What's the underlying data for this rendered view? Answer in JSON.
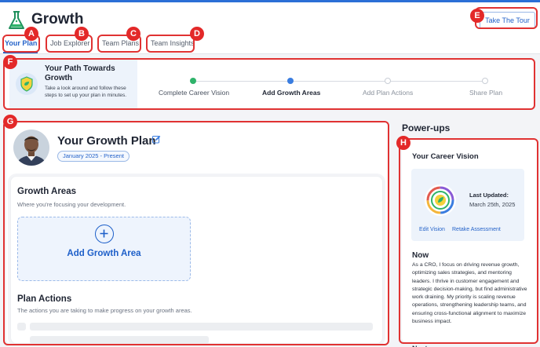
{
  "app": {
    "title": "Growth",
    "tour_button": "Take The Tour"
  },
  "tabs": [
    {
      "label": "Your Plan",
      "active": true
    },
    {
      "label": "Job Explorer",
      "active": false
    },
    {
      "label": "Team Plans",
      "active": false
    },
    {
      "label": "Team Insights",
      "active": false
    }
  ],
  "annotations": [
    "A",
    "B",
    "C",
    "D",
    "E",
    "F",
    "G",
    "H"
  ],
  "path": {
    "title": "Your Path Towards Growth",
    "description": "Take a look around and follow these steps to set up your plan in minutes.",
    "steps": [
      {
        "label": "Complete Career Vision",
        "status": "complete"
      },
      {
        "label": "Add Growth Areas",
        "status": "current"
      },
      {
        "label": "Add Plan Actions",
        "status": "pending"
      },
      {
        "label": "Share Plan",
        "status": "pending"
      }
    ]
  },
  "plan": {
    "title": "Your Growth Plan",
    "date_range": "January 2025 - Present",
    "growth_areas": {
      "title": "Growth Areas",
      "subtitle": "Where you're focusing your development.",
      "add_label": "Add Growth Area"
    },
    "plan_actions": {
      "title": "Plan Actions",
      "subtitle": "The actions you are taking to make progress on your growth areas."
    }
  },
  "powerups": {
    "title": "Power-ups",
    "vision": {
      "title": "Your Career Vision",
      "last_updated_label": "Last Updated:",
      "last_updated_date": "March 25th, 2025",
      "edit_link": "Edit Vision",
      "retake_link": "Retake Assessment"
    },
    "now": {
      "title": "Now",
      "text": "As a CRO, I focus on driving revenue growth, optimizing sales strategies, and mentoring leaders. I thrive in customer engagement and strategic decision-making, but find administrative work draining. My priority is scaling revenue operations, strengthening leadership teams, and ensuring cross-functional alignment to maximize business impact."
    },
    "next_title": "Next"
  },
  "colors": {
    "accent": "#2563c9",
    "highlight": "#e03232",
    "step_complete": "#2fb36a",
    "step_current": "#3a7de0",
    "step_pending": "#c9ced6"
  }
}
